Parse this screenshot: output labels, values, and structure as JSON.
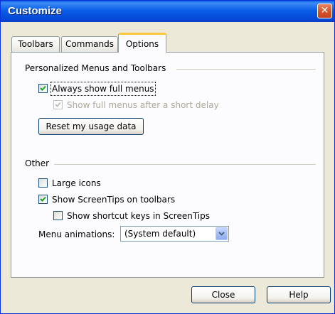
{
  "window": {
    "title": "Customize",
    "close_glyph": "✕"
  },
  "tabs": [
    {
      "label": "Toolbars",
      "active": false
    },
    {
      "label": "Commands",
      "active": false
    },
    {
      "label": "Options",
      "active": true
    }
  ],
  "personalized": {
    "heading": "Personalized Menus and Toolbars",
    "always_show_full_menus": {
      "label": "Always show full menus",
      "checked": true,
      "enabled": true
    },
    "show_after_delay": {
      "label": "Show full menus after a short delay",
      "checked": true,
      "enabled": false
    },
    "reset_button": "Reset my usage data"
  },
  "other": {
    "heading": "Other",
    "large_icons": {
      "label": "Large icons",
      "checked": false
    },
    "show_screentips": {
      "label": "Show ScreenTips on toolbars",
      "checked": true
    },
    "show_shortcut_keys": {
      "label": "Show shortcut keys in ScreenTips",
      "checked": false
    },
    "menu_animations_label": "Menu animations:",
    "menu_animations_value": "(System default)"
  },
  "footer": {
    "close_button": "Close",
    "help_button": "Help"
  },
  "colors": {
    "titlebar": "#0a5ee8",
    "tab_highlight": "#ffc83c",
    "checkmark": "#21a121",
    "close_button": "#d3522b"
  }
}
